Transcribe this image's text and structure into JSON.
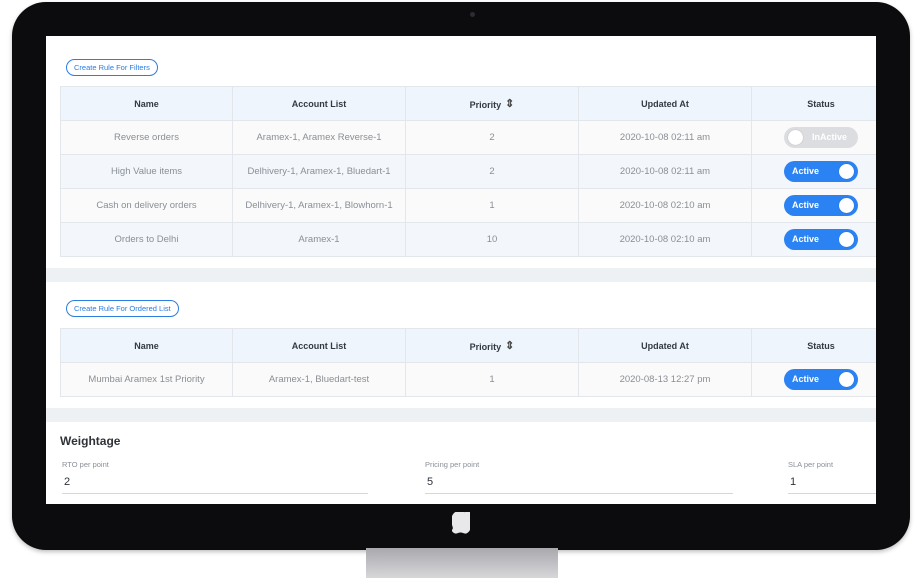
{
  "filters": {
    "create_button": "Create Rule For Filters",
    "columns": [
      "Name",
      "Account List",
      "Priority",
      "Updated At",
      "Status"
    ],
    "rows": [
      {
        "name": "Reverse orders",
        "accounts": "Aramex-1, Aramex Reverse-1",
        "priority": "2",
        "updated": "2020-10-08 02:11 am",
        "status": "InActive",
        "active": false
      },
      {
        "name": "High Value items",
        "accounts": "Delhivery-1, Aramex-1, Bluedart-1",
        "priority": "2",
        "updated": "2020-10-08 02:11 am",
        "status": "Active",
        "active": true
      },
      {
        "name": "Cash on delivery orders",
        "accounts": "Delhivery-1, Aramex-1, Blowhorn-1",
        "priority": "1",
        "updated": "2020-10-08 02:10 am",
        "status": "Active",
        "active": true
      },
      {
        "name": "Orders to Delhi",
        "accounts": "Aramex-1",
        "priority": "10",
        "updated": "2020-10-08 02:10 am",
        "status": "Active",
        "active": true
      }
    ]
  },
  "ordered": {
    "create_button": "Create Rule For Ordered List",
    "columns": [
      "Name",
      "Account List",
      "Priority",
      "Updated At",
      "Status"
    ],
    "rows": [
      {
        "name": "Mumbai Aramex 1st Priority",
        "accounts": "Aramex-1, Bluedart-test",
        "priority": "1",
        "updated": "2020-08-13 12:27 pm",
        "status": "Active",
        "active": true
      }
    ]
  },
  "weightage": {
    "title": "Weightage",
    "fields": [
      {
        "label": "RTO per point",
        "value": "2"
      },
      {
        "label": "Pricing per point",
        "value": "5"
      },
      {
        "label": "SLA per point",
        "value": "1"
      }
    ]
  },
  "icons": {
    "sort": "sort-arrows-icon",
    "brand_logo": "apple-logo-icon"
  },
  "colors": {
    "accent": "#2b82f3",
    "header_bg": "#eef5fd",
    "inactive": "#dcdde0"
  }
}
